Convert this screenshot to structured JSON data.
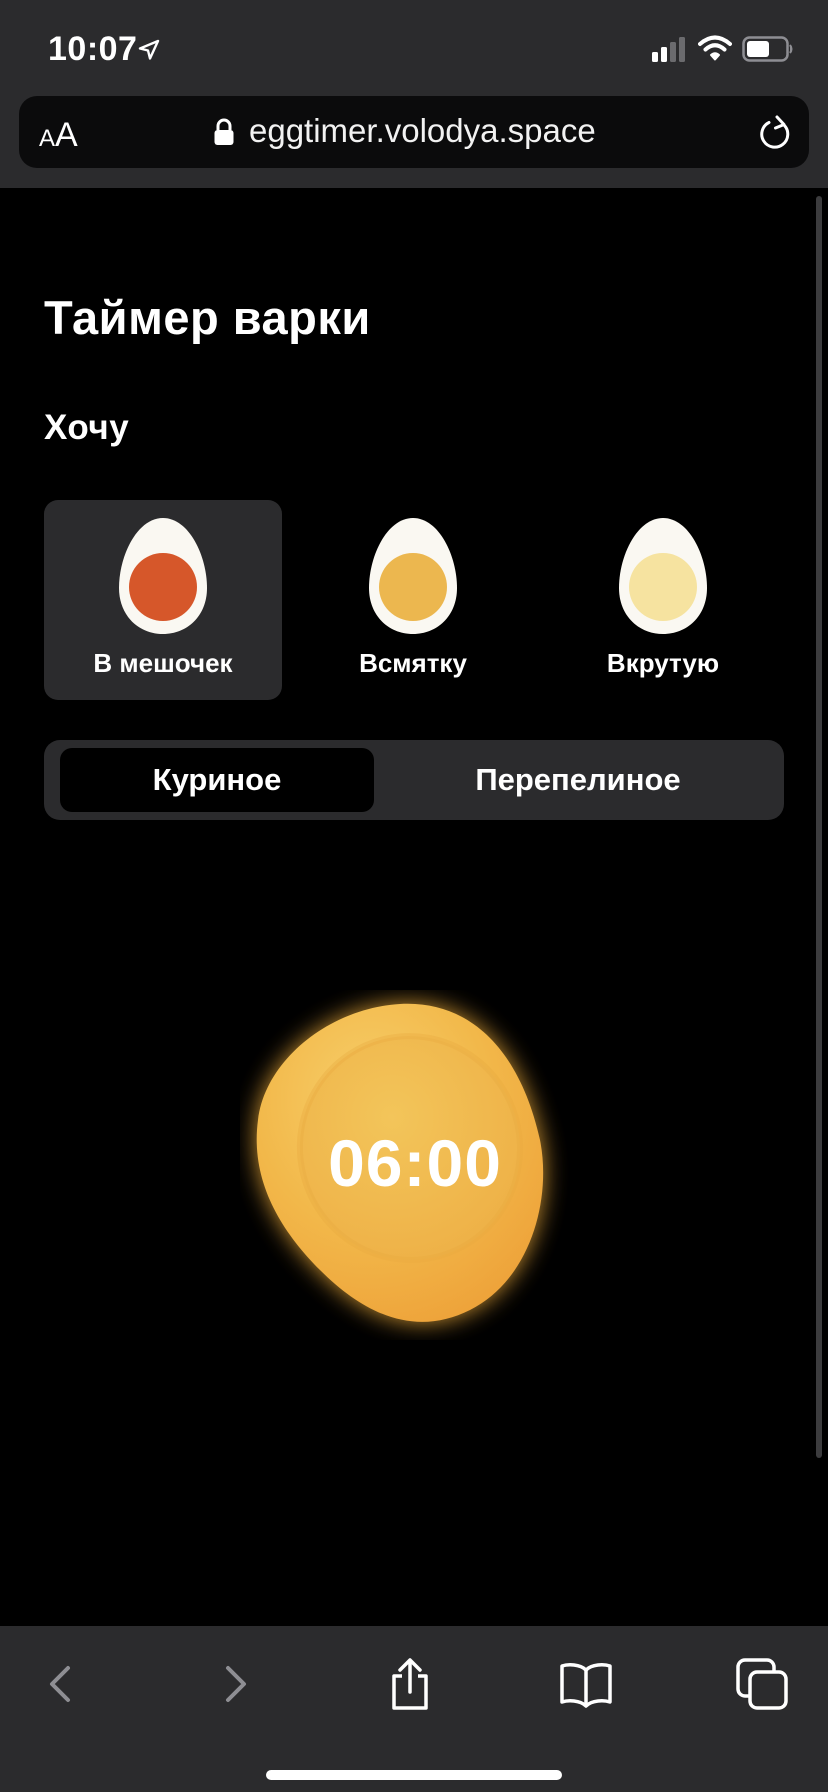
{
  "status_bar": {
    "time": "10:07"
  },
  "browser": {
    "text_size_small": "A",
    "text_size_big": "A",
    "url": "eggtimer.volodya.space"
  },
  "page": {
    "title": "Таймер варки",
    "want_label": "Хочу",
    "doneness_options": [
      {
        "label": "В мешочек",
        "yolk_color": "#d6572a",
        "selected": true
      },
      {
        "label": "Всмятку",
        "yolk_color": "#ecb74f",
        "selected": false
      },
      {
        "label": "Вкрутую",
        "yolk_color": "#f6e3a0",
        "selected": false
      }
    ],
    "egg_types": [
      {
        "label": "Куриное",
        "selected": true
      },
      {
        "label": "Перепелиное",
        "selected": false
      }
    ],
    "timer": "06:00"
  },
  "colors": {
    "background": "#000000",
    "chrome": "#2b2b2d",
    "timer_yolk": "#f2b84a"
  },
  "icons": {
    "back": "chevron-left-icon",
    "forward": "chevron-right-icon",
    "share": "share-icon",
    "bookmarks": "book-icon",
    "tabs": "tabs-icon"
  }
}
